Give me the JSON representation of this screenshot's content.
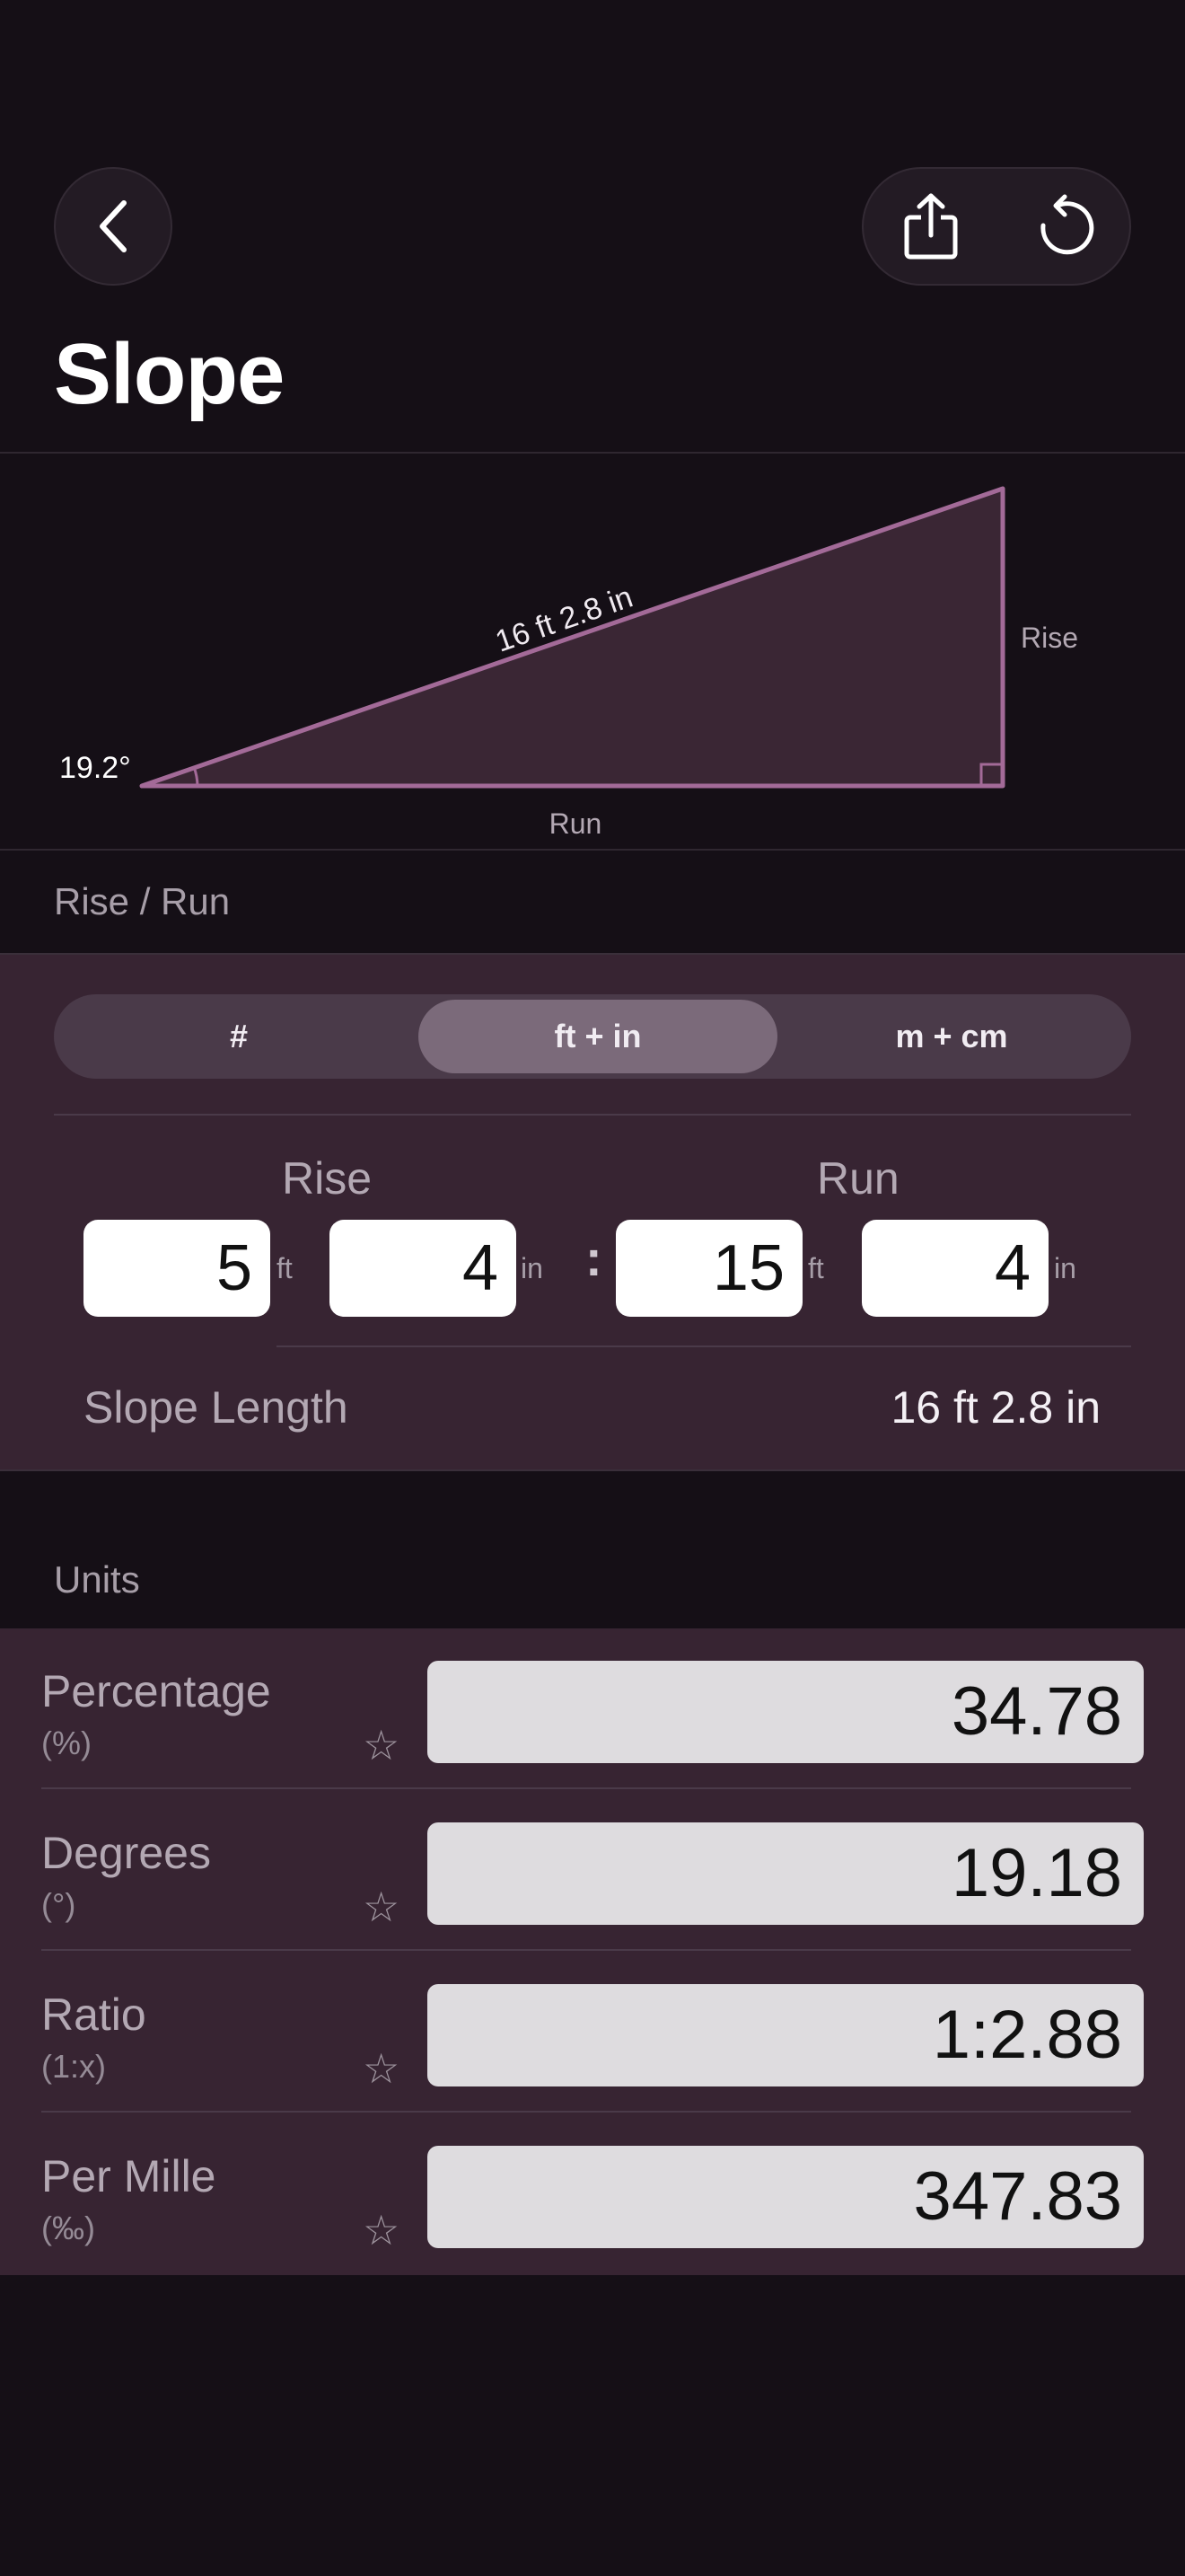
{
  "header": {
    "title": "Slope",
    "back_icon": "chevron-left-icon",
    "share_icon": "share-icon",
    "reset_icon": "rotate-ccw-icon"
  },
  "diagram": {
    "hypotenuse_label": "16 ft 2.8 in",
    "angle_label": "19.2°",
    "rise_label": "Rise",
    "run_label": "Run",
    "stroke_color": "#a36a98",
    "fill_color": "#3a2634"
  },
  "rise_run": {
    "section_label": "Rise / Run",
    "segments": [
      "#",
      "ft + in",
      "m + cm"
    ],
    "selected_segment": "ft + in",
    "rise_label": "Rise",
    "run_label": "Run",
    "rise_ft": "5",
    "rise_in": "4",
    "run_ft": "15",
    "run_in": "4",
    "unit_ft": "ft",
    "unit_in": "in",
    "separator": ":",
    "slope_length_label": "Slope Length",
    "slope_length_value": "16 ft 2.8 in"
  },
  "units": {
    "section_label": "Units",
    "rows": [
      {
        "label": "Percentage",
        "sub": "(%)",
        "value": "34.78"
      },
      {
        "label": "Degrees",
        "sub": "(°)",
        "value": "19.18"
      },
      {
        "label": "Ratio",
        "sub": "(1:x)",
        "value": "1:2.88"
      },
      {
        "label": "Per Mille",
        "sub": "(‰)",
        "value": "347.83"
      }
    ],
    "star_icon": "star-outline-icon"
  }
}
